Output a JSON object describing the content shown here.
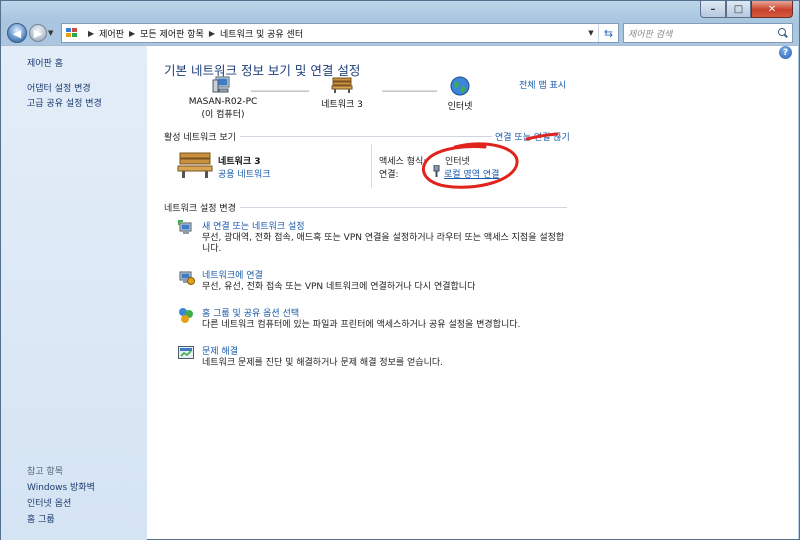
{
  "window": {
    "controls": {
      "minimize": "–",
      "maximize": "□",
      "close": "✕"
    }
  },
  "address": {
    "crumbs": [
      "제어판",
      "모든 제어판 항목",
      "네트워크 및 공유 센터"
    ],
    "search_placeholder": "제어판 검색"
  },
  "sidebar": {
    "items": [
      {
        "label": "제어판 홈"
      },
      {
        "label": "어댑터 설정 변경"
      },
      {
        "label": "고급 공유 설정 변경"
      }
    ],
    "see_also_label": "참고 항목",
    "see_also": [
      {
        "label": "Windows 방화벽"
      },
      {
        "label": "인터넷 옵션"
      },
      {
        "label": "홈 그룹"
      }
    ]
  },
  "main": {
    "title": "기본 네트워크 정보 보기 및 연결 설정",
    "full_map_link": "전체 맵 표시",
    "map": {
      "computer_name": "MASAN-R02-PC",
      "computer_sub": "(이 컴퓨터)",
      "network_name": "네트워크 3",
      "internet_name": "인터넷"
    },
    "active": {
      "section_label": "활성 네트워크 보기",
      "connect_link": "연결 또는 연결 끊기",
      "network_name": "네트워크 3",
      "network_type": "공용 네트워크",
      "access_type_label": "액세스 형식:",
      "access_type_value": "인터넷",
      "connection_label": "연결:",
      "connection_value": "로컬 영역 연결"
    },
    "settings": {
      "section_label": "네트워크 설정 변경",
      "tasks": [
        {
          "title": "새 연결 또는 네트워크 설정",
          "desc": "무선, 광대역, 전화 접속, 애드혹 또는 VPN 연결을 설정하거나 라우터 또는 액세스 지점을 설정합니다."
        },
        {
          "title": "네트워크에 연결",
          "desc": "무선, 유선, 전화 접속 또는 VPN 네트워크에 연결하거나 다시 연결합니다"
        },
        {
          "title": "홈 그룹 및 공유 옵션 선택",
          "desc": "다른 네트워크 컴퓨터에 있는 파일과 프린터에 액세스하거나 공유 설정을 변경합니다."
        },
        {
          "title": "문제 해결",
          "desc": "네트워크 문제를 진단 및 해결하거나 문제 해결 정보를 얻습니다."
        }
      ]
    }
  },
  "colors": {
    "link": "#1a5aa8",
    "title": "#1d3e78",
    "annotation": "#e0231c"
  }
}
